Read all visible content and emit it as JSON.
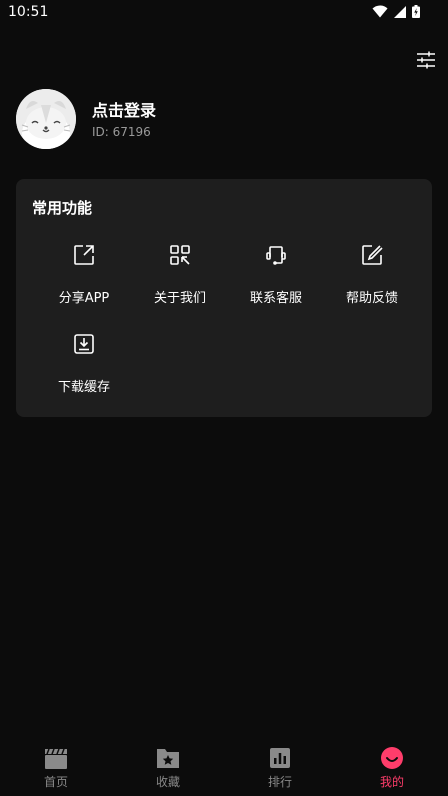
{
  "status_bar": {
    "time": "10:51"
  },
  "profile": {
    "login_prompt": "点击登录",
    "id_label": "ID: 67196"
  },
  "functions": {
    "title": "常用功能",
    "items": [
      {
        "label": "分享APP",
        "icon": "share-icon"
      },
      {
        "label": "关于我们",
        "icon": "qr-code-icon"
      },
      {
        "label": "联系客服",
        "icon": "customer-service-icon"
      },
      {
        "label": "帮助反馈",
        "icon": "edit-feedback-icon"
      },
      {
        "label": "下载缓存",
        "icon": "download-icon"
      }
    ]
  },
  "tabbar": {
    "tabs": [
      {
        "label": "首页",
        "icon": "clapperboard-icon"
      },
      {
        "label": "收藏",
        "icon": "folder-star-icon"
      },
      {
        "label": "排行",
        "icon": "bar-chart-icon"
      },
      {
        "label": "我的",
        "icon": "smile-face-icon",
        "active": true
      }
    ]
  },
  "colors": {
    "accent": "#ff3d6b",
    "card": "#1e1e1e",
    "background": "#0c0c0c"
  }
}
